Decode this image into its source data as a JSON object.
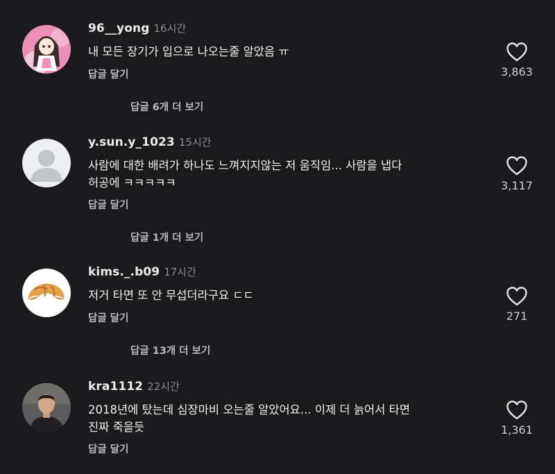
{
  "comments": [
    {
      "username": "96__yong",
      "time": "16시간",
      "text": "내 모든 장기가 입으로 나오는줄 알았음 ㅠ",
      "reply_label": "답글 달기",
      "likes": "3,863",
      "more_replies": "답글 6개 더 보기",
      "avatar": "anime-girl-avatar"
    },
    {
      "username": "y.sun.y_1023",
      "time": "15시간",
      "text": "사람에 대한 배려가 하나도 느껴지지않는 저 움직임... 사람을 냅다\n허공에 ㅋㅋㅋㅋㅋ",
      "reply_label": "답글 달기",
      "likes": "3,117",
      "more_replies": "답글 1개 더 보기",
      "avatar": "default-user-avatar"
    },
    {
      "username": "kims._.b09",
      "time": "17시간",
      "text": "저거 타면 또 안 무섭더라구요 ㄷㄷ",
      "reply_label": "답글 달기",
      "likes": "271",
      "more_replies": "답글 13개 더 보기",
      "avatar": "croissant-avatar"
    },
    {
      "username": "kra1112",
      "time": "22시간",
      "text": "2018년에 탔는데 심장마비 오는줄 알았어요... 이제 더 늙어서 타면\n진짜 죽을듯",
      "reply_label": "답글 달기",
      "likes": "1,361",
      "more_replies": "",
      "avatar": "man-photo-avatar"
    }
  ],
  "colors": {
    "background": "#1a1a1c",
    "text": "#f3f3f3",
    "muted": "#8d8d90",
    "secondary": "#b9b9bc"
  },
  "icons": {
    "like": "heart-outline-icon"
  }
}
